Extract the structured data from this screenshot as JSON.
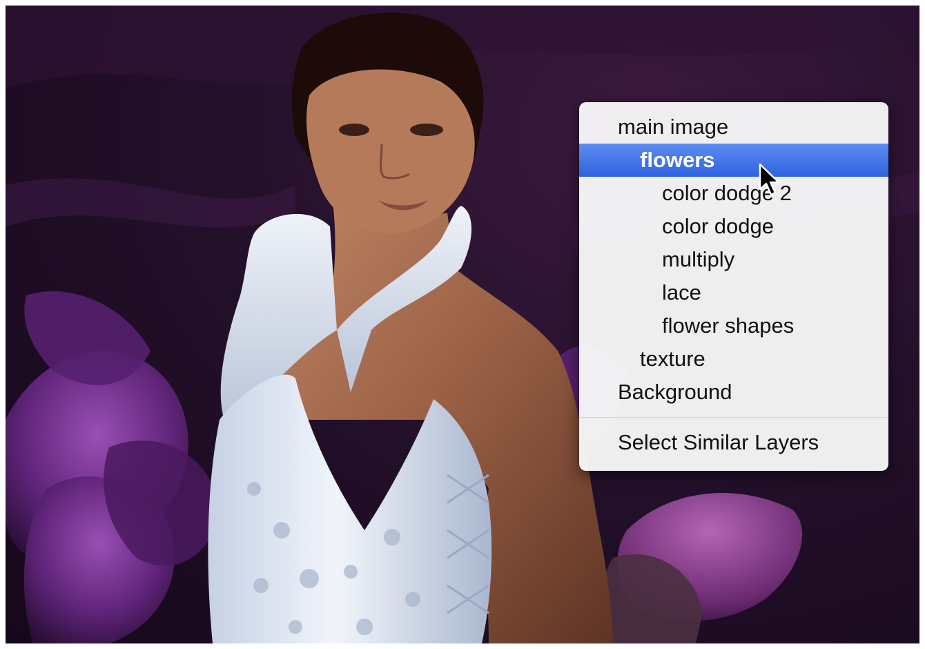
{
  "layers_menu": {
    "items": [
      {
        "label": "main image",
        "level": 0,
        "selected": false
      },
      {
        "label": "flowers",
        "level": 1,
        "selected": true
      },
      {
        "label": "color dodge 2",
        "level": 2,
        "selected": false
      },
      {
        "label": "color dodge",
        "level": 2,
        "selected": false
      },
      {
        "label": "multiply",
        "level": 2,
        "selected": false
      },
      {
        "label": "lace",
        "level": 2,
        "selected": false
      },
      {
        "label": "flower shapes",
        "level": 2,
        "selected": false
      },
      {
        "label": "texture",
        "level": 1,
        "selected": false
      },
      {
        "label": "Background",
        "level": 0,
        "selected": false
      }
    ],
    "select_similar_label": "Select Similar Layers"
  },
  "colors": {
    "menu_highlight": "#3a6ee5",
    "canvas_background": "#24102a",
    "petal": "#6a2c8a",
    "dress": "#dfe6f2",
    "skin": "#a26a4d"
  },
  "icons": {
    "cursor": "arrow-pointer-icon"
  }
}
